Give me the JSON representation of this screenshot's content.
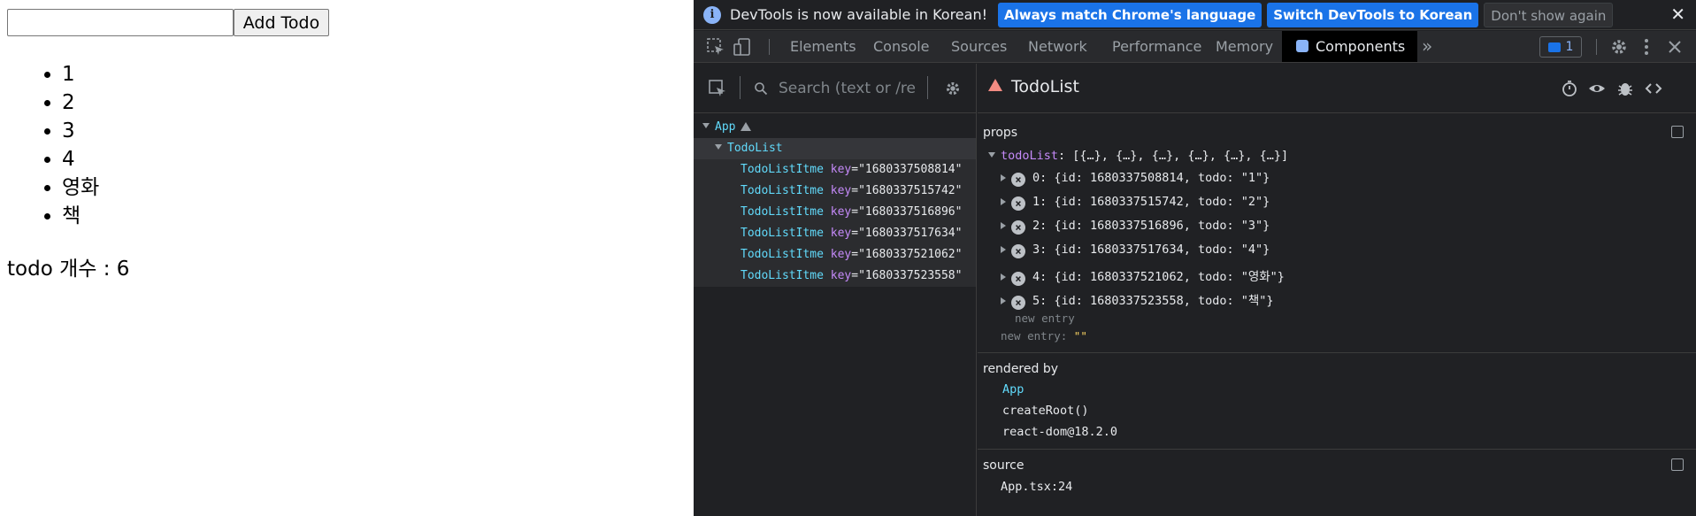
{
  "app": {
    "input_value": "",
    "add_button": "Add Todo",
    "todos": [
      "1",
      "2",
      "3",
      "4",
      "영화",
      "책"
    ],
    "count_text": "todo 개수 : 6"
  },
  "devtools": {
    "infobar": {
      "text": "DevTools is now available in Korean!",
      "btn_match": "Always match Chrome's language",
      "btn_switch": "Switch DevTools to Korean",
      "btn_dismiss": "Don't show again"
    },
    "tabs": {
      "elements": "Elements",
      "console": "Console",
      "sources": "Sources",
      "network": "Network",
      "performance": "Performance",
      "memory": "Memory",
      "components": "Components",
      "more": "»",
      "issues_count": "1"
    },
    "tree": {
      "search_placeholder": "Search (text or /re",
      "root": "App",
      "selected": "TodoList",
      "item_component": "TodoListItme",
      "key_label": "key",
      "keys": [
        "\"1680337508814\"",
        "\"1680337515742\"",
        "\"1680337516896\"",
        "\"1680337517634\"",
        "\"1680337521062\"",
        "\"1680337523558\""
      ]
    },
    "props_panel": {
      "component_name": "TodoList",
      "props_label": "props",
      "prop_name": "todoList",
      "prop_summary": ": [{…}, {…}, {…}, {…}, {…}, {…}]",
      "entries": [
        {
          "index": "0",
          "text": ": {id: 1680337508814, todo: \"1\"}"
        },
        {
          "index": "1",
          "text": ": {id: 1680337515742, todo: \"2\"}"
        },
        {
          "index": "2",
          "text": ": {id: 1680337516896, todo: \"3\"}"
        },
        {
          "index": "3",
          "text": ": {id: 1680337517634, todo: \"4\"}"
        },
        {
          "index": "4",
          "text": ": {id: 1680337521062, todo: \"영화\"}"
        },
        {
          "index": "5",
          "text": ": {id: 1680337523558, todo: \"책\"}"
        }
      ],
      "new_entry_inner": "new entry",
      "new_entry_outer": "new entry",
      "new_entry_value": "\"\"",
      "rendered_by_label": "rendered by",
      "rendered_by": [
        "App",
        "createRoot()",
        "react-dom@18.2.0"
      ],
      "source_label": "source",
      "source_value": "App.tsx:24"
    }
  }
}
